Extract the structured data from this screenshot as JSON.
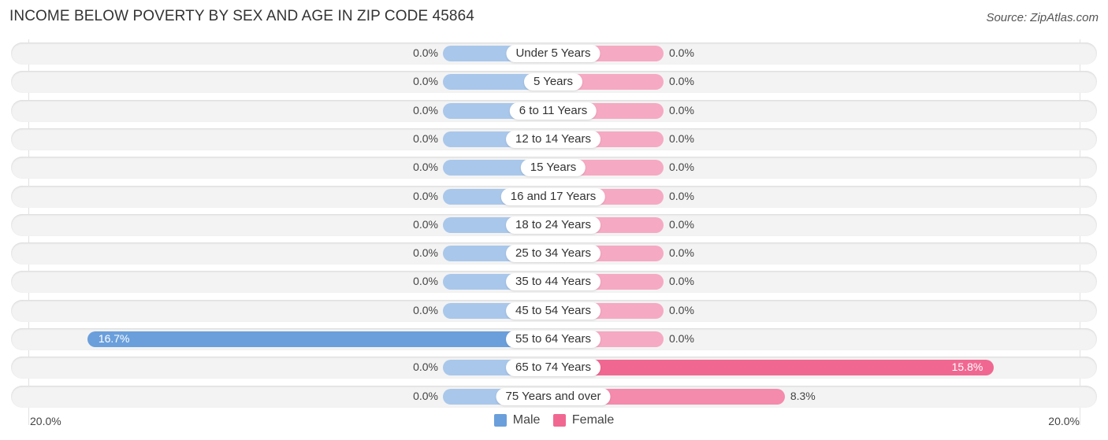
{
  "title": "INCOME BELOW POVERTY BY SEX AND AGE IN ZIP CODE 45864",
  "source": "Source: ZipAtlas.com",
  "chart_data": {
    "type": "bar",
    "orientation": "horizontal-diverging",
    "title": "INCOME BELOW POVERTY BY SEX AND AGE IN ZIP CODE 45864",
    "categories": [
      "Under 5 Years",
      "5 Years",
      "6 to 11 Years",
      "12 to 14 Years",
      "15 Years",
      "16 and 17 Years",
      "18 to 24 Years",
      "25 to 34 Years",
      "35 to 44 Years",
      "45 to 54 Years",
      "55 to 64 Years",
      "65 to 74 Years",
      "75 Years and over"
    ],
    "series": [
      {
        "name": "Male",
        "color": "#6a9fdb",
        "values": [
          0.0,
          0.0,
          0.0,
          0.0,
          0.0,
          0.0,
          0.0,
          0.0,
          0.0,
          0.0,
          16.7,
          0.0,
          0.0
        ],
        "labels": [
          "0.0%",
          "0.0%",
          "0.0%",
          "0.0%",
          "0.0%",
          "0.0%",
          "0.0%",
          "0.0%",
          "0.0%",
          "0.0%",
          "16.7%",
          "0.0%",
          "0.0%"
        ]
      },
      {
        "name": "Female",
        "color": "#f06892",
        "values": [
          0.0,
          0.0,
          0.0,
          0.0,
          0.0,
          0.0,
          0.0,
          0.0,
          0.0,
          0.0,
          0.0,
          15.8,
          8.3
        ],
        "labels": [
          "0.0%",
          "0.0%",
          "0.0%",
          "0.0%",
          "0.0%",
          "0.0%",
          "0.0%",
          "0.0%",
          "0.0%",
          "0.0%",
          "0.0%",
          "15.8%",
          "8.3%"
        ]
      }
    ],
    "xlim": [
      -20,
      20
    ],
    "axis_labels": {
      "left": "20.0%",
      "right": "20.0%"
    },
    "legend": {
      "position": "bottom-center",
      "entries": [
        "Male",
        "Female"
      ]
    },
    "colors": {
      "male_light": "#a9c7ea",
      "male_strong": "#6a9fdb",
      "female_light": "#f6a9c2",
      "female_strong": "#f06892"
    }
  }
}
